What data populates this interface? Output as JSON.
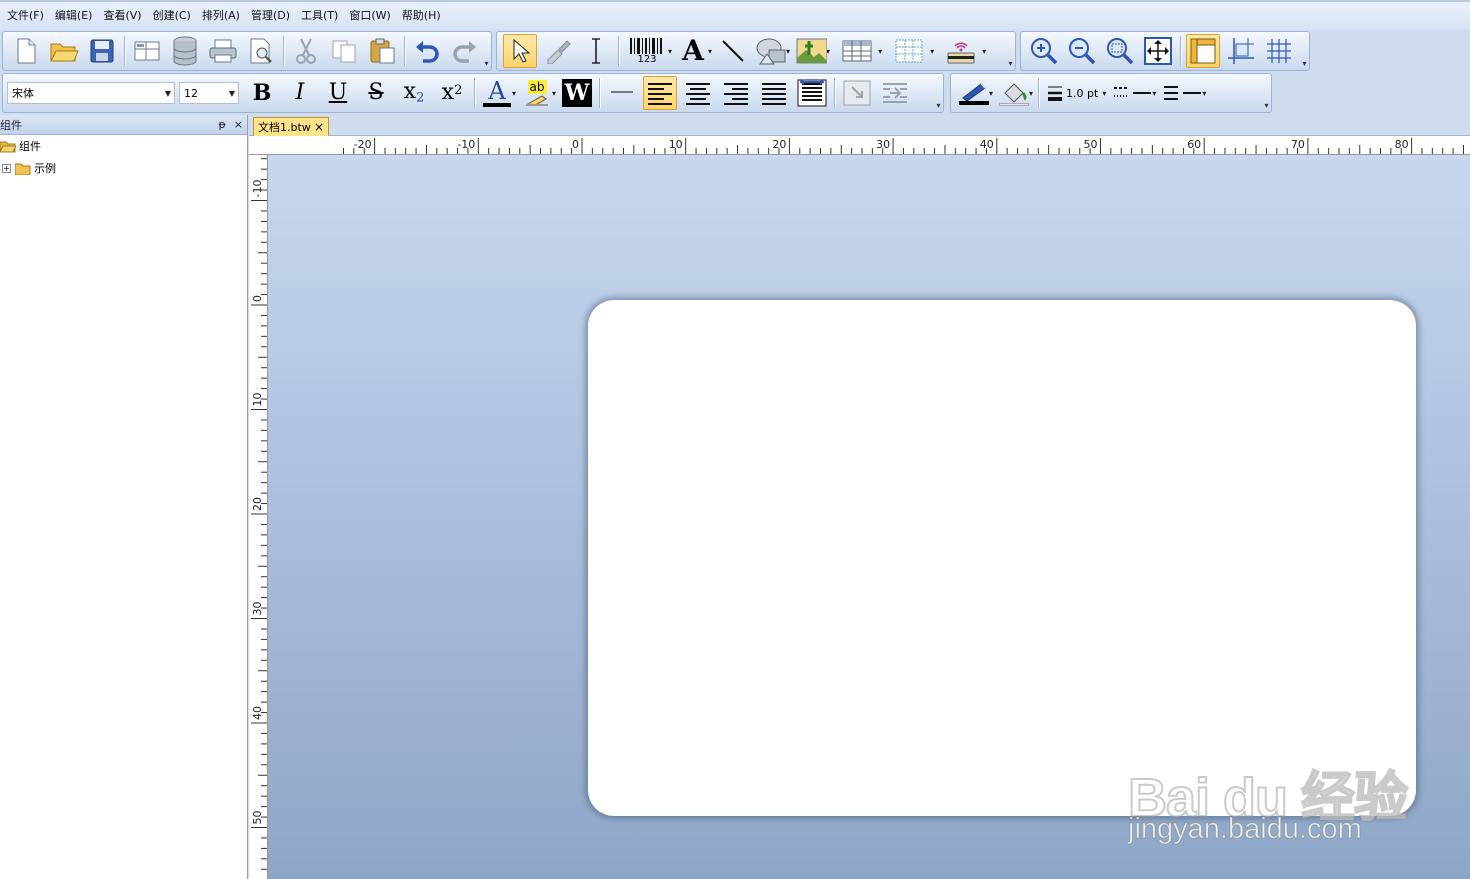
{
  "menubar": {
    "items": [
      "文件(F)",
      "编辑(E)",
      "查看(V)",
      "创建(C)",
      "排列(A)",
      "管理(D)",
      "工具(T)",
      "窗口(W)",
      "帮助(H)"
    ]
  },
  "toolbar_top": {
    "barcode_caption": "123"
  },
  "toolbar_format": {
    "font_name": "宋体",
    "font_size": "12",
    "bold_glyph": "B",
    "italic_glyph": "I",
    "underline_glyph": "U",
    "strike_glyph": "S",
    "subscript_base": "x",
    "subscript_index": "2",
    "superscript_base": "x",
    "superscript_index": "2",
    "font_color_glyph": "A",
    "highlight_glyph": "ab",
    "word_glyph": "W",
    "line_width": "1.0 pt"
  },
  "panel": {
    "title": "组件",
    "pin": "ᵽ",
    "close": "×",
    "tree": {
      "root_label": "组件",
      "child_label": "示例",
      "expander": "+"
    }
  },
  "document": {
    "tab_label": "文档1.btw",
    "tab_close": "×"
  },
  "rulers": {
    "horizontal_labels": [
      "-20",
      "-10",
      "0",
      "10",
      "20",
      "30",
      "40",
      "50",
      "60",
      "70",
      "80"
    ],
    "vertical_labels": [
      "-10",
      "0",
      "10",
      "20",
      "30",
      "40",
      "50"
    ]
  },
  "watermark": {
    "brand": "Bai du 经验",
    "url": "jingyan.baidu.com"
  },
  "colors": {
    "accent_active": "#ffd46a",
    "canvas_top": "#c7d7ee",
    "canvas_bottom": "#8da6c8",
    "font_color_bar": "#000000"
  }
}
